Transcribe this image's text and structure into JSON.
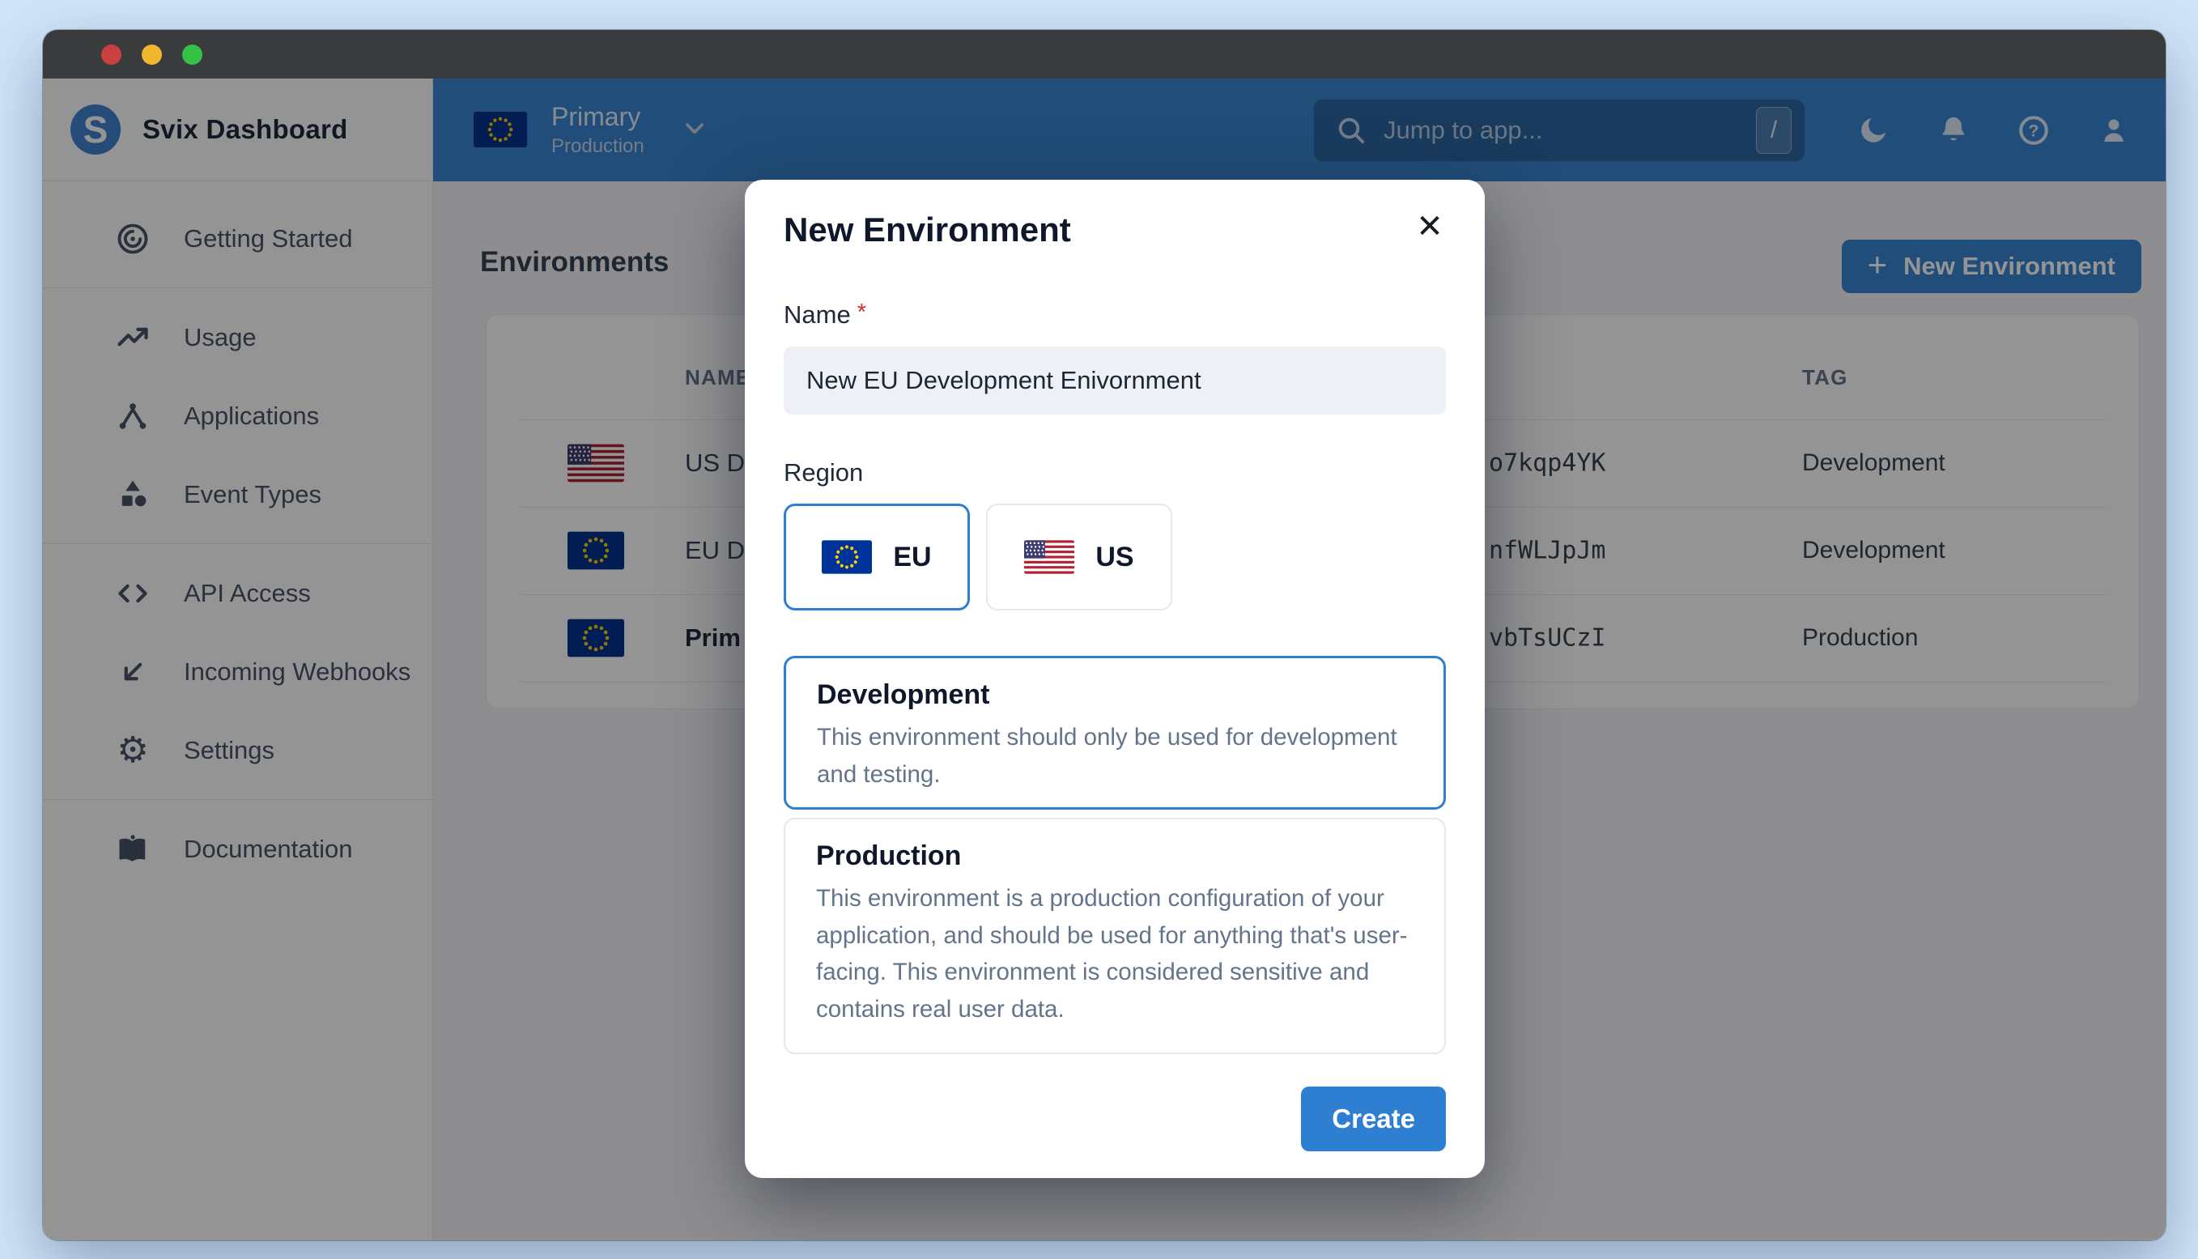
{
  "window_controls": {
    "buttons": [
      "close",
      "minimize",
      "maximize"
    ]
  },
  "brand": {
    "name": "Svix Dashboard",
    "logo_letter": "S"
  },
  "sidebar": {
    "items": [
      {
        "icon": "goal-icon",
        "label": "Getting Started"
      },
      {
        "icon": "trend-up-icon",
        "label": "Usage"
      },
      {
        "icon": "network-icon",
        "label": "Applications"
      },
      {
        "icon": "shapes-icon",
        "label": "Event Types"
      },
      {
        "icon": "code-icon",
        "label": "API Access"
      },
      {
        "icon": "arrow-down-left-icon",
        "label": "Incoming Webhooks"
      },
      {
        "icon": "gear-icon",
        "label": "Settings"
      },
      {
        "icon": "book-icon",
        "label": "Documentation"
      }
    ]
  },
  "topbar": {
    "environment": {
      "name": "Primary",
      "tag": "Production",
      "flag": "eu"
    },
    "search": {
      "placeholder": "Jump to app...",
      "shortcut_key": "/"
    },
    "icons": [
      "moon-icon",
      "bell-icon",
      "help-icon",
      "user-icon"
    ]
  },
  "main": {
    "heading": "Environments",
    "new_environment_button": "New Environment",
    "table": {
      "name_header": "NAME",
      "tag_header": "TAG",
      "rows": [
        {
          "flag": "us",
          "name": "US D",
          "env_id": "o7kqp4YK",
          "tag": "Development",
          "bold": false
        },
        {
          "flag": "eu",
          "name": "EU D",
          "env_id": "nfWLJpJm",
          "tag": "Development",
          "bold": false
        },
        {
          "flag": "eu",
          "name": "Prim",
          "env_id": "vbTsUCzI",
          "tag": "Production",
          "bold": true
        }
      ]
    }
  },
  "modal": {
    "title": "New Environment",
    "close_glyph": "✕",
    "name_label": "Name",
    "required_mark": "*",
    "name_value": "New EU Development Enivornment",
    "region_label": "Region",
    "regions": [
      {
        "label": "EU",
        "flag": "eu",
        "selected": true
      },
      {
        "label": "US",
        "flag": "us",
        "selected": false
      }
    ],
    "env_types": [
      {
        "title": "Development",
        "description": "This environment should only be used for development\nand testing.",
        "selected": true
      },
      {
        "title": "Production",
        "description": "This environment is a production configuration of your\napplication, and should be used for anything that's user-\nfacing. This environment is considered sensitive and\ncontains real user data.",
        "selected": false
      }
    ],
    "create_button": "Create"
  },
  "colors": {
    "accent_blue": "#2e7fd2",
    "topbar_blue": "#3285d8",
    "required_red": "#d93025",
    "eu_flag_blue": "#003399",
    "eu_star_yellow": "#ffcc00",
    "us_flag_red": "#b22234",
    "us_flag_blue": "#3c3b6e",
    "traffic_red": "#c8403f",
    "traffic_yellow": "#f2b62e",
    "traffic_green": "#35c048",
    "desktop_background": "#d0e4f9"
  }
}
